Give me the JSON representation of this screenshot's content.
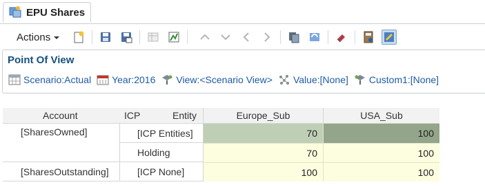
{
  "tab": {
    "label": "EPU Shares"
  },
  "toolbar": {
    "actions_label": "Actions"
  },
  "pov": {
    "title": "Point Of View",
    "items": [
      {
        "label": "Scenario:Actual",
        "icon": "scenario-icon"
      },
      {
        "label": "Year:2016",
        "icon": "calendar-icon"
      },
      {
        "label": "View:<Scenario View>",
        "icon": "view-icon"
      },
      {
        "label": "Value:[None]",
        "icon": "value-icon"
      },
      {
        "label": "Custom1:[None]",
        "icon": "custom-icon"
      }
    ]
  },
  "grid": {
    "headers": {
      "account": "Account",
      "icp": "ICP",
      "entity": "Entity",
      "col1": "Europe_Sub",
      "col2": "USA_Sub"
    },
    "rows": [
      {
        "account": "[SharesOwned]",
        "icp": "[ICP Entities]",
        "v1": "70",
        "v2": "100"
      },
      {
        "account": "",
        "icp": "Holding",
        "v1": "70",
        "v2": "100"
      },
      {
        "account": "[SharesOutstanding]",
        "icp": "[ICP None]",
        "v1": "100",
        "v2": "100"
      }
    ]
  },
  "colors": {
    "pov_title": "#15507e",
    "pov_link": "#1f5aa6",
    "cell_yellow": "#fdfde0",
    "cell_green_light": "#bfcfb6",
    "cell_green_dark": "#93a58a"
  }
}
